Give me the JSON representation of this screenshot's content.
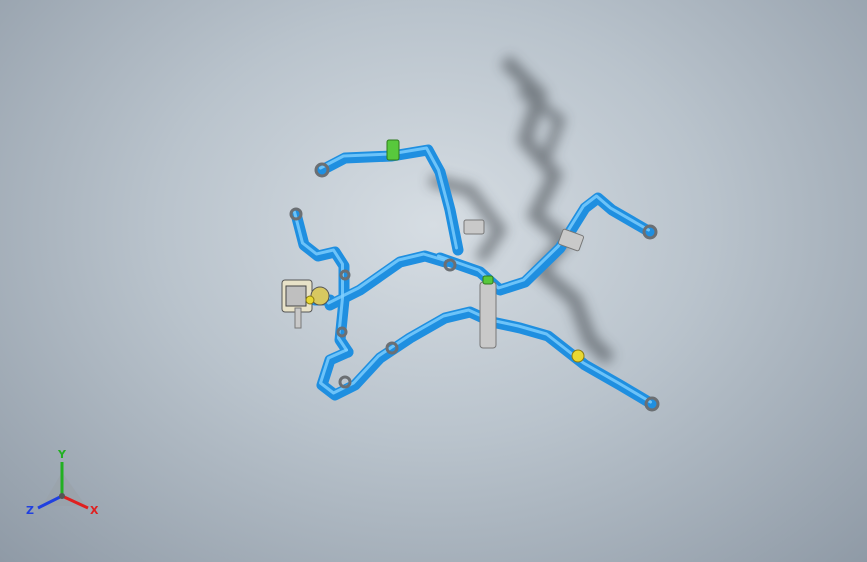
{
  "viewport": {
    "background_top": "#d6dde3",
    "background_bottom": "#8f9aa6"
  },
  "model": {
    "hose_color": "#1f8fe0",
    "hose_highlight": "#7fd0ff",
    "clamp_color": "#6b6f73",
    "clip_green": "#58c83c",
    "clip_yellow": "#e8d832",
    "bracket_color": "#c9c9c9",
    "shadow_color": "#3a3f45"
  },
  "triad": {
    "x_label": "X",
    "y_label": "Y",
    "z_label": "Z",
    "x_color": "#e02020",
    "y_color": "#22b022",
    "z_color": "#2040e0"
  }
}
